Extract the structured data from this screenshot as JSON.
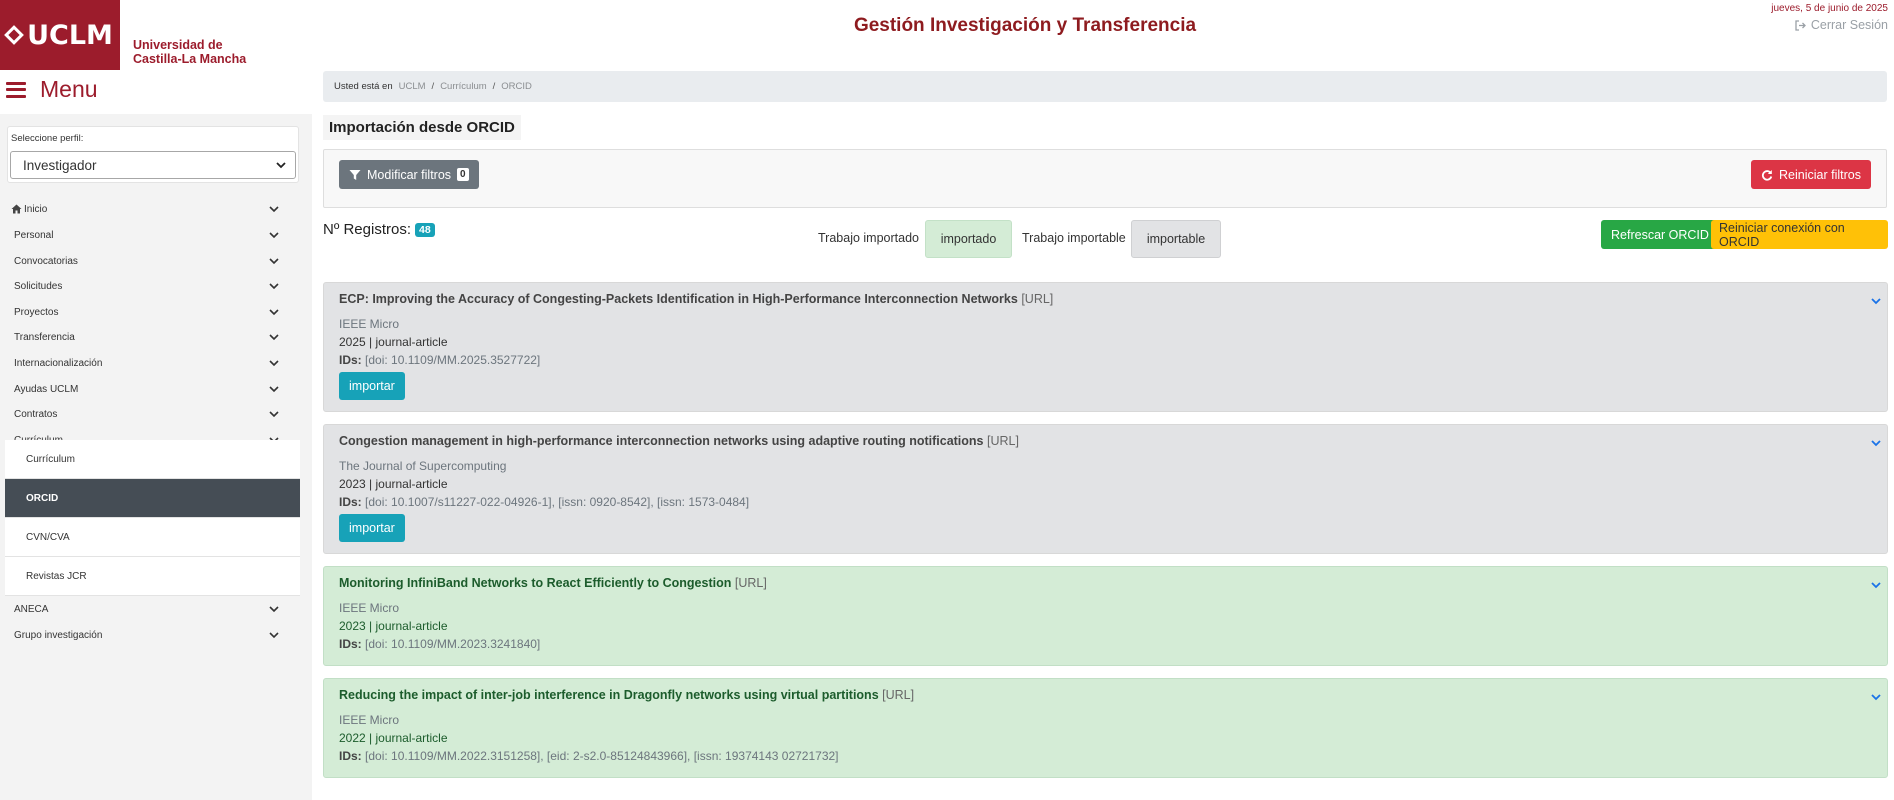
{
  "header": {
    "logo_text": "UCLM",
    "university_line1": "Universidad de",
    "university_line2": "Castilla-La Mancha",
    "app_title": "Gestión Investigación y Transferencia",
    "date": "jueves, 5 de junio de 2025",
    "logout_label": "Cerrar Sesión"
  },
  "sidebar": {
    "menu_label": "Menu",
    "profile_label": "Seleccione perfil:",
    "profile_value": "Investigador",
    "items": [
      {
        "label": "Inicio"
      },
      {
        "label": "Personal"
      },
      {
        "label": "Convocatorias"
      },
      {
        "label": "Solicitudes"
      },
      {
        "label": "Proyectos"
      },
      {
        "label": "Transferencia"
      },
      {
        "label": "Internacionalización"
      },
      {
        "label": "Ayudas UCLM"
      },
      {
        "label": "Contratos"
      },
      {
        "label": "Currículum"
      }
    ],
    "subitems": [
      {
        "label": "Currículum"
      },
      {
        "label": "ORCID"
      },
      {
        "label": "CVN/CVA"
      },
      {
        "label": "Revistas JCR"
      }
    ],
    "items_after": [
      {
        "label": "ANECA"
      },
      {
        "label": "Grupo investigación"
      }
    ]
  },
  "breadcrumb": {
    "prefix": "Usted está en",
    "crumbs": [
      "UCLM",
      "Currículum",
      "ORCID"
    ]
  },
  "main": {
    "page_title": "Importación desde ORCID",
    "filters_button": "Modificar filtros",
    "filters_count": "0",
    "reset_filters": "Reiniciar filtros",
    "records_label": "Nº Registros:",
    "records_count": "48",
    "legend_imported_label": "Trabajo importado",
    "legend_imported_box": "importado",
    "legend_importable_label": "Trabajo importable",
    "legend_importable_box": "importable",
    "refresh_button": "Refrescar ORCID",
    "reconnect_button": "Reiniciar conexión con ORCID",
    "import_button": "importar",
    "url_label": "[URL]",
    "ids_label": "IDs:"
  },
  "records": [
    {
      "status": "importable",
      "title": "ECP: Improving the Accuracy of Congesting-Packets Identification in High-Performance Interconnection Networks",
      "journal": "IEEE Micro",
      "year_type": "2025 | journal-article",
      "ids": "[doi: 10.1109/MM.2025.3527722]"
    },
    {
      "status": "importable",
      "title": "Congestion management in high-performance interconnection networks using adaptive routing notifications",
      "journal": "The Journal of Supercomputing",
      "year_type": "2023 | journal-article",
      "ids": "[doi: 10.1007/s11227-022-04926-1], [issn: 0920-8542], [issn: 1573-0484]"
    },
    {
      "status": "imported",
      "title": "Monitoring InfiniBand Networks to React Efficiently to Congestion",
      "journal": "IEEE Micro",
      "year_type": "2023 | journal-article",
      "ids": "[doi: 10.1109/MM.2023.3241840]"
    },
    {
      "status": "imported",
      "title": "Reducing the impact of inter-job interference in Dragonfly networks using virtual partitions",
      "journal": "IEEE Micro",
      "year_type": "2022 | journal-article",
      "ids": "[doi: 10.1109/MM.2022.3151258], [eid: 2-s2.0-85124843966], [issn: 19374143 02721732]"
    }
  ],
  "colors": {
    "brand": "#9c1c2c",
    "importable_bg": "#e2e3e5",
    "imported_bg": "#d4ecd6",
    "info": "#17a2b8",
    "danger": "#dc3545",
    "success": "#28a745",
    "warning": "#ffc107"
  },
  "icons": {
    "logout": "sign-out-icon",
    "home": "home-icon",
    "filter": "filter-icon",
    "refresh": "refresh-icon",
    "chevron": "chevron-down-icon"
  }
}
